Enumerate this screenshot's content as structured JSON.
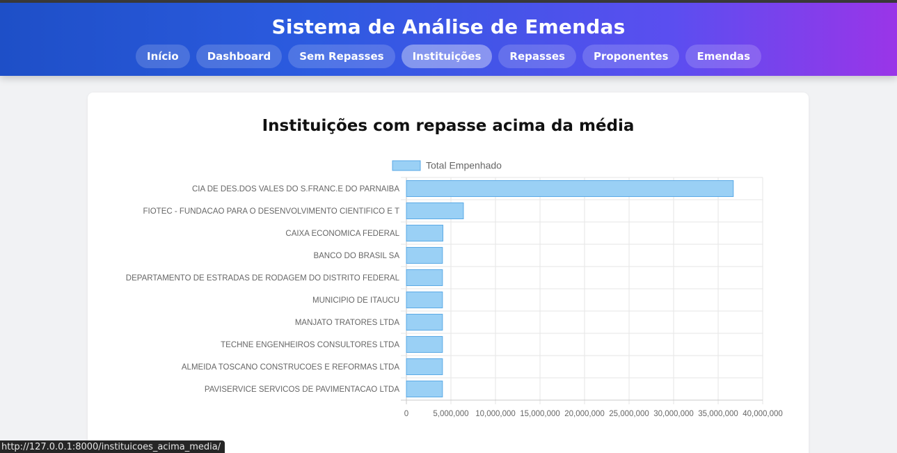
{
  "site": {
    "title": "Sistema de Análise de Emendas"
  },
  "nav": {
    "items": [
      {
        "label": "Início",
        "active": false
      },
      {
        "label": "Dashboard",
        "active": false
      },
      {
        "label": "Sem Repasses",
        "active": false
      },
      {
        "label": "Instituições",
        "active": true
      },
      {
        "label": "Repasses",
        "active": false
      },
      {
        "label": "Proponentes",
        "active": false
      },
      {
        "label": "Emendas",
        "active": false
      }
    ]
  },
  "page": {
    "title": "Instituições com repasse acima da média"
  },
  "chart_data": {
    "type": "bar",
    "orientation": "horizontal",
    "categories": [
      "CIA DE DES.DOS VALES DO S.FRANC.E DO PARNAIBA",
      "FIOTEC - FUNDACAO PARA O DESENVOLVIMENTO CIENTIFICO E T",
      "CAIXA ECONOMICA FEDERAL",
      "BANCO DO BRASIL SA",
      "DEPARTAMENTO DE ESTRADAS DE RODAGEM DO DISTRITO FEDERAL",
      "MUNICIPIO DE ITAUCU",
      "MANJATO TRATORES LTDA",
      "TECHNE ENGENHEIROS CONSULTORES LTDA",
      "ALMEIDA TOSCANO CONSTRUCOES E REFORMAS LTDA",
      "PAVISERVICE SERVICOS DE PAVIMENTACAO LTDA"
    ],
    "series": [
      {
        "name": "Total Empenhado",
        "values": [
          36700000,
          6400000,
          4100000,
          4050000,
          4050000,
          4050000,
          4050000,
          4050000,
          4050000,
          4050000
        ],
        "color": "#9ad0f5",
        "border_color": "#5aa9e6"
      }
    ],
    "xlim": [
      0,
      40000000
    ],
    "xticks": [
      "0",
      "5,000,000",
      "10,000,000",
      "15,000,000",
      "20,000,000",
      "25,000,000",
      "30,000,000",
      "35,000,000",
      "40,000,000"
    ],
    "grid": true,
    "legend_position": "top"
  },
  "status_bar": {
    "url": "http://127.0.0.1:8000/instituicoes_acima_media/"
  }
}
